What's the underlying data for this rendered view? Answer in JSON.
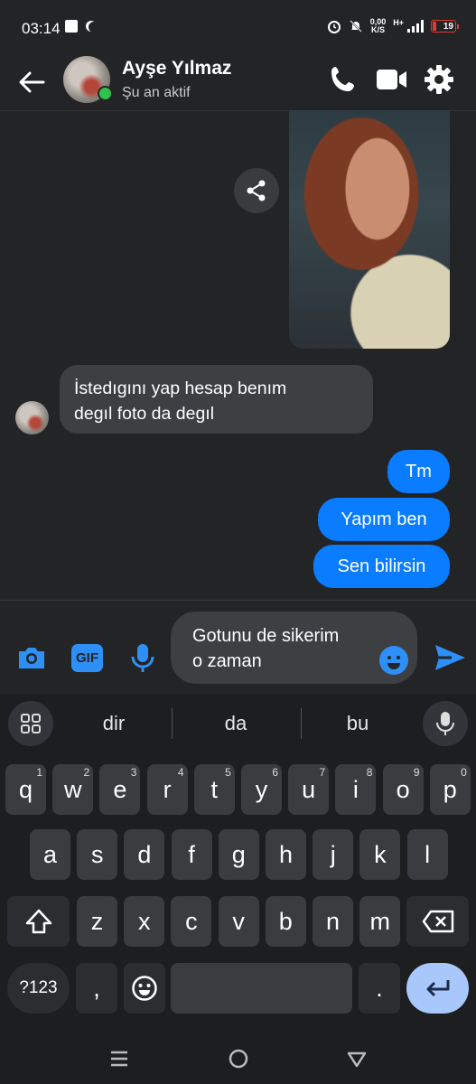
{
  "status": {
    "time": "03:14",
    "net_speed_top": "0,00",
    "net_speed_bottom": "K/S",
    "network_type": "H+",
    "battery": "19"
  },
  "header": {
    "name": "Ayşe Yılmaz",
    "status": "Şu an aktif"
  },
  "messages": [
    {
      "from": "them",
      "text_line1": "İstedıgını yap hesap benım",
      "text_line2": "degıl foto da degıl"
    },
    {
      "from": "me",
      "text": "Tm"
    },
    {
      "from": "me",
      "text": "Yapım ben"
    },
    {
      "from": "me",
      "text": "Sen bilirsin"
    }
  ],
  "composer": {
    "line1": "Gotunu de sikerim",
    "line2": "o zaman",
    "gif_label": "GIF"
  },
  "keyboard": {
    "suggestions": [
      "dir",
      "da",
      "bu"
    ],
    "row1": [
      {
        "k": "q",
        "h": "1"
      },
      {
        "k": "w",
        "h": "2"
      },
      {
        "k": "e",
        "h": "3"
      },
      {
        "k": "r",
        "h": "4"
      },
      {
        "k": "t",
        "h": "5"
      },
      {
        "k": "y",
        "h": "6"
      },
      {
        "k": "u",
        "h": "7"
      },
      {
        "k": "i",
        "h": "8"
      },
      {
        "k": "o",
        "h": "9"
      },
      {
        "k": "p",
        "h": "0"
      }
    ],
    "row2": [
      "a",
      "s",
      "d",
      "f",
      "g",
      "h",
      "j",
      "k",
      "l"
    ],
    "row3": [
      "z",
      "x",
      "c",
      "v",
      "b",
      "n",
      "m"
    ],
    "symbols_label": "?123",
    "comma": ",",
    "period": "."
  },
  "colors": {
    "accent": "#0a7cff",
    "background": "#232426",
    "online": "#31c24d",
    "battery_low": "#e53935"
  }
}
